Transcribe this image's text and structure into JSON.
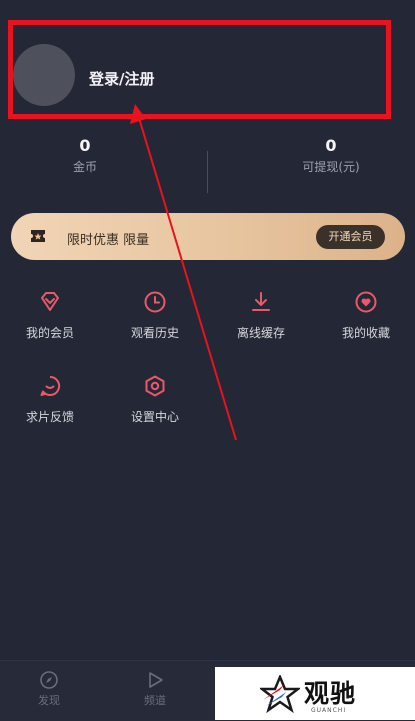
{
  "header": {
    "login_label": "登录/注册"
  },
  "stats": [
    {
      "value": "0",
      "label": "金币"
    },
    {
      "value": "0",
      "label": "可提现(元)"
    }
  ],
  "vip": {
    "text": "限时优惠 限量",
    "button": "开通会员"
  },
  "menu": [
    {
      "label": "我的会员",
      "icon": "diamond-icon"
    },
    {
      "label": "观看历史",
      "icon": "clock-icon"
    },
    {
      "label": "离线缓存",
      "icon": "download-icon"
    },
    {
      "label": "我的收藏",
      "icon": "heart-icon"
    },
    {
      "label": "求片反馈",
      "icon": "feedback-icon"
    },
    {
      "label": "设置中心",
      "icon": "settings-icon"
    }
  ],
  "tabs": [
    {
      "label": "发现",
      "icon": "compass-icon"
    },
    {
      "label": "频道",
      "icon": "play-icon"
    }
  ],
  "watermark": {
    "title": "观驰",
    "subtitle": "GUANCHI"
  },
  "colors": {
    "accent": "#e85a6a",
    "annotation": "#e8131f",
    "vip_gold": "#e6c39d",
    "background": "#242736"
  }
}
